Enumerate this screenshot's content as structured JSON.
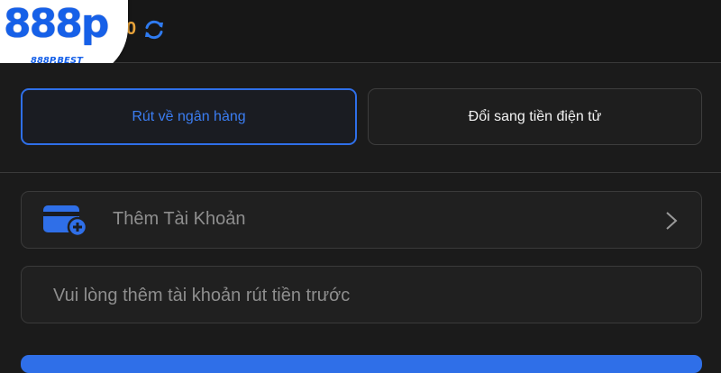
{
  "header": {
    "balance": "0"
  },
  "logo": {
    "text": "888p",
    "sub": "888P.BEST"
  },
  "tabs": [
    {
      "label": "Rút về ngân hàng",
      "active": true
    },
    {
      "label": "Đổi sang tiền điện tử",
      "active": false
    }
  ],
  "account": {
    "add_label": "Thêm Tài Khoản",
    "notice": "Vui lòng thêm tài khoản rút tiền trước"
  },
  "colors": {
    "accent": "#2f6fe8",
    "background": "#1b1b1b",
    "balance": "#e8a33a"
  },
  "icons": {
    "refresh": "refresh-icon",
    "add_card": "add-card-icon",
    "chevron": "chevron-right-icon"
  }
}
